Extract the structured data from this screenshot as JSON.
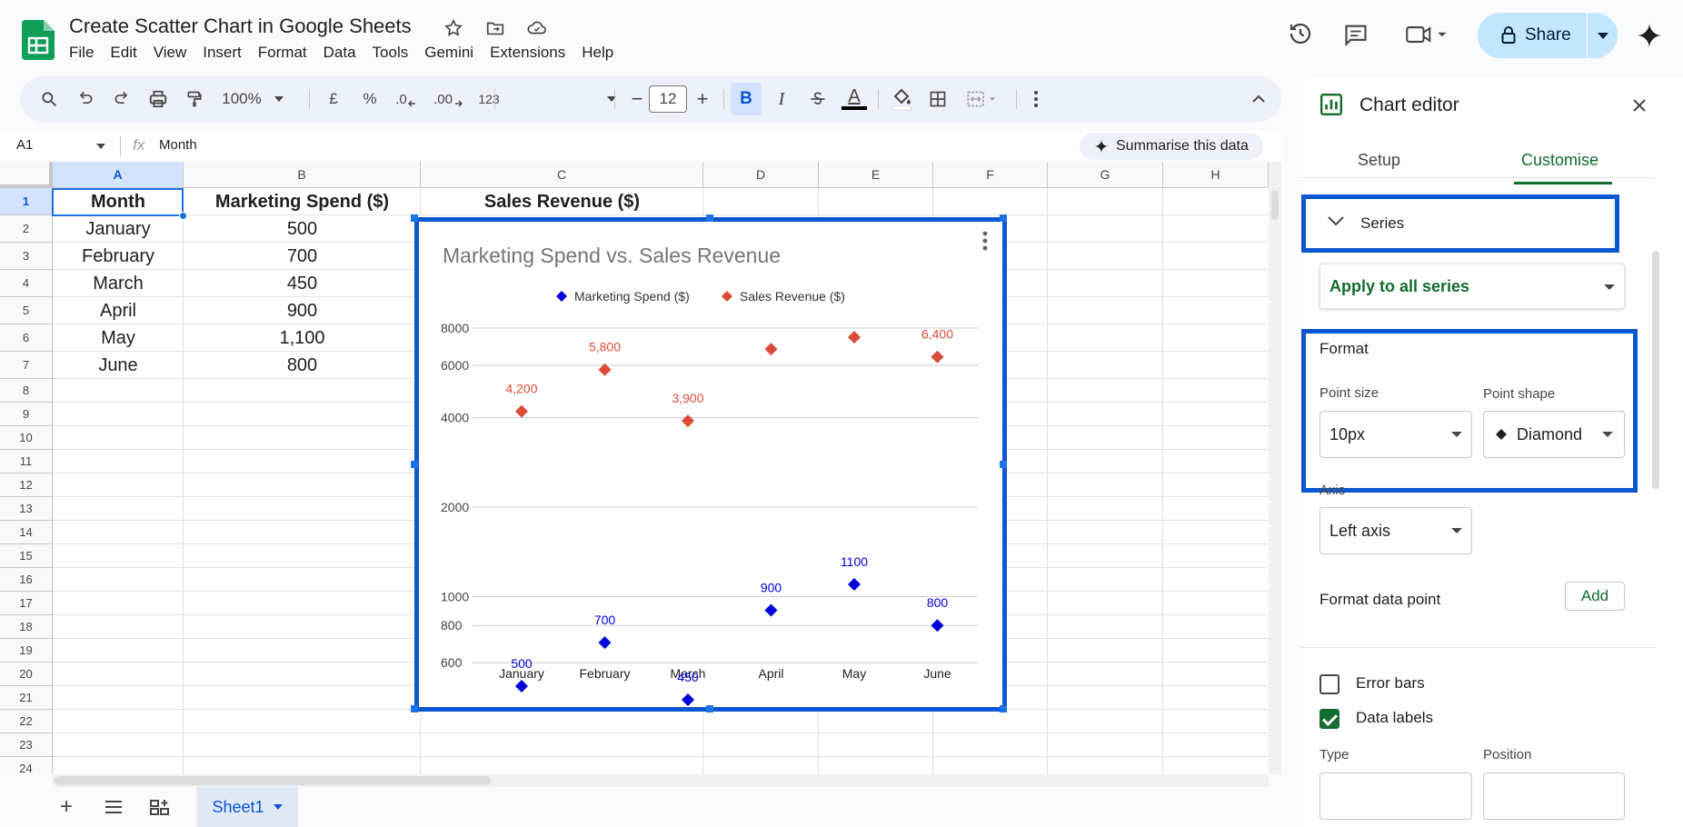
{
  "doc": {
    "title": "Create Scatter Chart in Google Sheets",
    "menu": [
      "File",
      "Edit",
      "View",
      "Insert",
      "Format",
      "Data",
      "Tools",
      "Gemini",
      "Extensions",
      "Help"
    ]
  },
  "header": {
    "share_label": "Share"
  },
  "toolbar": {
    "zoom": "100%",
    "currency": "£",
    "percent": "%",
    "dec_decrease": ".0",
    "dec_increase": ".00",
    "number_format": "123",
    "font_size": "12",
    "bold": "B",
    "italic": "I",
    "text_color": "A",
    "minus": "−",
    "plus": "+"
  },
  "formula": {
    "cell_ref": "A1",
    "fx": "fx",
    "value": "Month",
    "summarise_label": "Summarise this data"
  },
  "sheet": {
    "columns": [
      "A",
      "B",
      "C",
      "D",
      "E",
      "F",
      "G",
      "H"
    ],
    "rows": [
      "1",
      "2",
      "3",
      "4",
      "5",
      "6",
      "7",
      "8",
      "9",
      "10",
      "11",
      "12",
      "13",
      "14",
      "15",
      "16",
      "17",
      "18",
      "19",
      "20",
      "21",
      "22",
      "23",
      "24"
    ],
    "header": [
      "Month",
      "Marketing Spend ($)",
      "Sales Revenue ($)"
    ],
    "data": [
      [
        "January",
        "500"
      ],
      [
        "February",
        "700"
      ],
      [
        "March",
        "450"
      ],
      [
        "April",
        "900"
      ],
      [
        "May",
        "1,100"
      ],
      [
        "June",
        "800"
      ]
    ],
    "tab_name": "Sheet1"
  },
  "chart_data": {
    "type": "scatter",
    "title": "Marketing Spend vs. Sales Revenue",
    "categories": [
      "January",
      "February",
      "March",
      "April",
      "May",
      "June"
    ],
    "series": [
      {
        "name": "Marketing Spend ($)",
        "color": "#0000dd",
        "values": [
          500,
          700,
          450,
          900,
          1100,
          800
        ],
        "labels": [
          "500",
          "700",
          "450",
          "900",
          "1100",
          "800"
        ]
      },
      {
        "name": "Sales Revenue ($)",
        "color": "#dd4b39",
        "values": [
          4200,
          5800,
          3900,
          6800,
          8000,
          6400
        ],
        "labels": [
          "4,200",
          "5,800",
          "3,900",
          "",
          "",
          "6,400"
        ]
      }
    ],
    "yticks": [
      600,
      800,
      1000,
      2000,
      4000,
      6000,
      8000
    ],
    "ytick_labels": [
      "600",
      "800",
      "1000",
      "2000",
      "4000",
      "6000",
      "8000"
    ],
    "scale": "log",
    "legend": "top",
    "grid": true
  },
  "editor": {
    "title": "Chart editor",
    "tab_setup": "Setup",
    "tab_customise": "Customise",
    "section_series": "Series",
    "apply_to": "Apply to all series",
    "format_label": "Format",
    "point_size_label": "Point size",
    "point_size_value": "10px",
    "point_shape_label": "Point shape",
    "point_shape_value": "Diamond",
    "axis_label": "Axis",
    "axis_value": "Left axis",
    "format_data_point": "Format data point",
    "add_label": "Add",
    "error_bars": "Error bars",
    "data_labels": "Data labels",
    "type_label": "Type",
    "position_label": "Position"
  }
}
